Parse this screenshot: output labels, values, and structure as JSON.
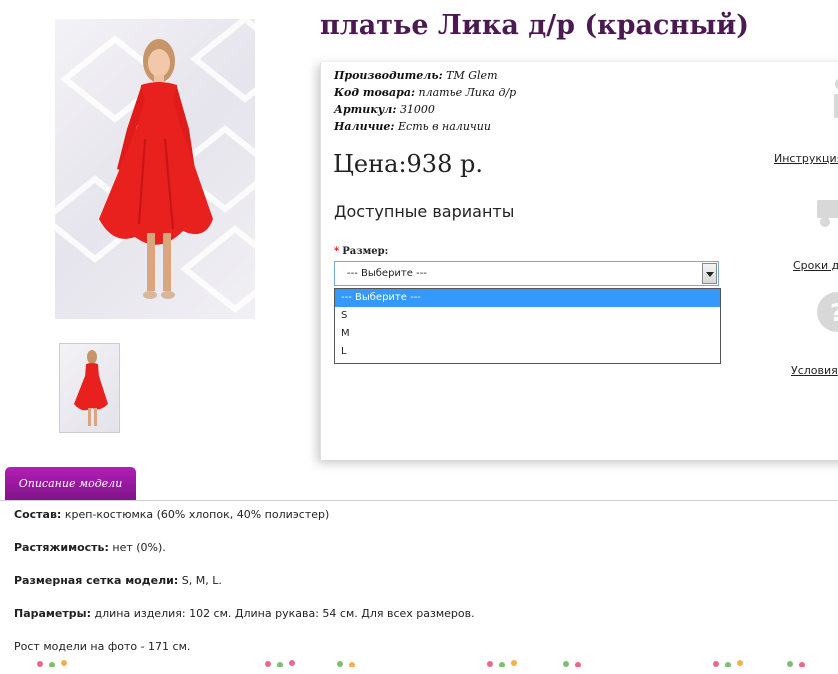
{
  "product": {
    "title": "платье Лика д/р (красный)",
    "manufacturer_label": "Производитель:",
    "manufacturer_value": "TM Glem",
    "code_label": "Код товара:",
    "code_value": "платье Лика д/р",
    "sku_label": "Артикул:",
    "sku_value": "31000",
    "stock_label": "Наличие:",
    "stock_value": "Есть в наличии",
    "price": "Цена:938 р."
  },
  "options": {
    "heading": "Доступные варианты",
    "size_label": "Размер:",
    "required_mark": "*",
    "selected": "--- Выберите ---",
    "items": [
      "--- Выберите ---",
      "S",
      "M",
      "L"
    ]
  },
  "side_links": {
    "instruction": "Инструкция",
    "delivery": "Сроки до",
    "terms": "Условия"
  },
  "tabs": {
    "description": "Описание модели"
  },
  "description": {
    "composition_label": "Состав:",
    "composition_value": "креп-костюмка (60% хлопок, 40% полиэстер)",
    "stretch_label": "Растяжимость:",
    "stretch_value": "нет (0%).",
    "sizes_label": "Размерная сетка модели:",
    "sizes_value": "S, M, L.",
    "params_label": "Параметры:",
    "params_value": "длина изделия: 102 см. Длина рукава: 54 см. Для всех размеров.",
    "height_text": "Рост модели на фото - 171 см."
  },
  "colors": {
    "title": "#4a1a50",
    "tab": "#9b19a2",
    "dress": "#e8201e",
    "select_highlight": "#3399ff",
    "required": "#ee0000"
  }
}
